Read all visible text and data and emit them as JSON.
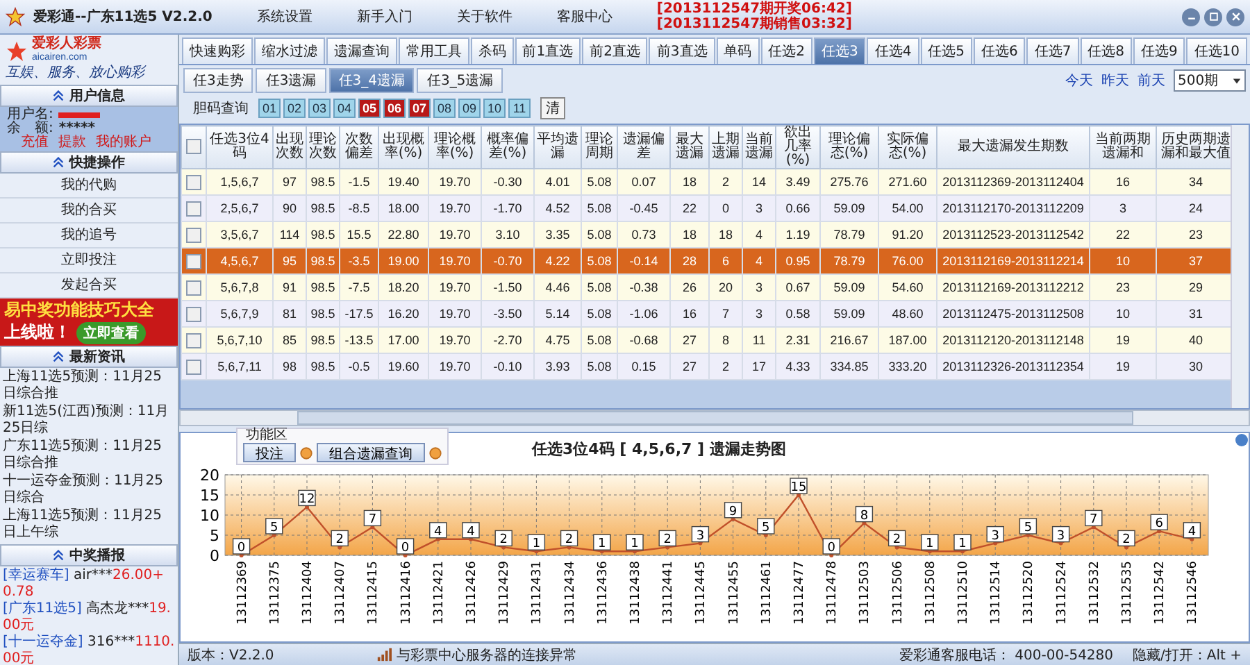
{
  "window": {
    "title": "爱彩通--广东11选5  V2.2.0"
  },
  "menu": [
    "系统设置",
    "新手入门",
    "关于软件",
    "客服中心"
  ],
  "notices": [
    "[2013112547期开奖06:42]",
    "[2013112547期销售03:32]"
  ],
  "sidebar": {
    "logo": {
      "name": "爱彩人彩票",
      "site": "aicairen.com",
      "slogan": "互娱、服务、放心购彩"
    },
    "user_info": {
      "heading": "用户信息",
      "username_label": "用户名:",
      "balance_label": "余　额:",
      "balance": "*****",
      "links": [
        "充值",
        "提款",
        "我的账户"
      ]
    },
    "quick_ops": {
      "heading": "快捷操作",
      "items": [
        "我的代购",
        "我的合买",
        "我的追号",
        "立即投注",
        "发起合买"
      ]
    },
    "banner": {
      "headline": "易中奖功能技巧大全",
      "subline": "上线啦！",
      "button": "立即查看"
    },
    "news": {
      "heading": "最新资讯",
      "items": [
        "上海11选5预测：11月25日综合推",
        "新11选5(江西)预测：11月25日综",
        "广东11选5预测：11月25日综合推",
        "十一运夺金预测：11月25日综合",
        "上海11选5预测：11月25日上午综"
      ]
    },
    "winners": {
      "heading": "中奖播报",
      "items": [
        {
          "lottery": "[幸运赛车]",
          "user": "air***",
          "amount": "26.00+0.78"
        },
        {
          "lottery": "[广东11选5]",
          "user": "高杰龙***",
          "amount": "19.00元"
        },
        {
          "lottery": "[十一运夺金]",
          "user": "316***",
          "amount": "1110.00元"
        }
      ]
    }
  },
  "tabs": [
    {
      "label": "快速购彩",
      "selected": false
    },
    {
      "label": "缩水过滤",
      "selected": false
    },
    {
      "label": "遗漏查询",
      "selected": false
    },
    {
      "label": "常用工具",
      "selected": false
    },
    {
      "label": "杀码",
      "selected": false
    },
    {
      "label": "前1直选",
      "selected": false
    },
    {
      "label": "前2直选",
      "selected": false
    },
    {
      "label": "前3直选",
      "selected": false
    },
    {
      "label": "单码",
      "selected": false
    },
    {
      "label": "任选2",
      "selected": false
    },
    {
      "label": "任选3",
      "selected": true
    },
    {
      "label": "任选4",
      "selected": false
    },
    {
      "label": "任选5",
      "selected": false
    },
    {
      "label": "任选6",
      "selected": false
    },
    {
      "label": "任选7",
      "selected": false
    },
    {
      "label": "任选8",
      "selected": false
    },
    {
      "label": "任选9",
      "selected": false
    },
    {
      "label": "任选10",
      "selected": false
    }
  ],
  "sub_tabs": [
    {
      "label": "任3走势",
      "selected": false
    },
    {
      "label": "任3遗漏",
      "selected": false
    },
    {
      "label": "任3_4遗漏",
      "selected": true
    },
    {
      "label": "任3_5遗漏",
      "selected": false
    }
  ],
  "day_links": [
    "今天",
    "昨天",
    "前天"
  ],
  "period_select": "500期",
  "number_filter": {
    "label": "胆码查询",
    "clear": "清",
    "numbers": [
      {
        "label": "01",
        "selected": false
      },
      {
        "label": "02",
        "selected": false
      },
      {
        "label": "03",
        "selected": false
      },
      {
        "label": "04",
        "selected": false
      },
      {
        "label": "05",
        "selected": true
      },
      {
        "label": "06",
        "selected": true
      },
      {
        "label": "07",
        "selected": true
      },
      {
        "label": "08",
        "selected": false
      },
      {
        "label": "09",
        "selected": false
      },
      {
        "label": "10",
        "selected": false
      },
      {
        "label": "11",
        "selected": false
      }
    ]
  },
  "table": {
    "header_checked": false,
    "columns": [
      "任选3位4码",
      "出现次数",
      "理论次数",
      "次数偏差",
      "出现概率(%)",
      "理论概率(%)",
      "概率偏差(%)",
      "平均遗漏",
      "理论周期",
      "遗漏偏差",
      "最大遗漏",
      "上期遗漏",
      "当前遗漏",
      "欲出几率(%)",
      "理论偏态(%)",
      "实际偏态(%)",
      "最大遗漏发生期数",
      "当前两期遗漏和",
      "历史两期遗漏和最大值"
    ],
    "rows": [
      {
        "selected": false,
        "checked": false,
        "cells": [
          "1,5,6,7",
          "97",
          "98.5",
          "-1.5",
          "19.40",
          "19.70",
          "-0.30",
          "4.01",
          "5.08",
          "0.07",
          "18",
          "2",
          "14",
          "3.49",
          "275.76",
          "271.60",
          "2013112369-2013112404",
          "16",
          "34"
        ]
      },
      {
        "selected": false,
        "checked": false,
        "cells": [
          "2,5,6,7",
          "90",
          "98.5",
          "-8.5",
          "18.00",
          "19.70",
          "-1.70",
          "4.52",
          "5.08",
          "-0.45",
          "22",
          "0",
          "3",
          "0.66",
          "59.09",
          "54.00",
          "2013112170-2013112209",
          "3",
          "24"
        ]
      },
      {
        "selected": false,
        "checked": false,
        "cells": [
          "3,5,6,7",
          "114",
          "98.5",
          "15.5",
          "22.80",
          "19.70",
          "3.10",
          "3.35",
          "5.08",
          "0.73",
          "18",
          "18",
          "4",
          "1.19",
          "78.79",
          "91.20",
          "2013112523-2013112542",
          "22",
          "23"
        ]
      },
      {
        "selected": true,
        "checked": false,
        "cells": [
          "4,5,6,7",
          "95",
          "98.5",
          "-3.5",
          "19.00",
          "19.70",
          "-0.70",
          "4.22",
          "5.08",
          "-0.14",
          "28",
          "6",
          "4",
          "0.95",
          "78.79",
          "76.00",
          "2013112169-2013112214",
          "10",
          "37"
        ]
      },
      {
        "selected": false,
        "checked": false,
        "cells": [
          "5,6,7,8",
          "91",
          "98.5",
          "-7.5",
          "18.20",
          "19.70",
          "-1.50",
          "4.46",
          "5.08",
          "-0.38",
          "26",
          "20",
          "3",
          "0.67",
          "59.09",
          "54.60",
          "2013112169-2013112212",
          "23",
          "29"
        ]
      },
      {
        "selected": false,
        "checked": false,
        "cells": [
          "5,6,7,9",
          "81",
          "98.5",
          "-17.5",
          "16.20",
          "19.70",
          "-3.50",
          "5.14",
          "5.08",
          "-1.06",
          "16",
          "7",
          "3",
          "0.58",
          "59.09",
          "48.60",
          "2013112475-2013112508",
          "10",
          "31"
        ]
      },
      {
        "selected": false,
        "checked": false,
        "cells": [
          "5,6,7,10",
          "85",
          "98.5",
          "-13.5",
          "17.00",
          "19.70",
          "-2.70",
          "4.75",
          "5.08",
          "-0.68",
          "27",
          "8",
          "11",
          "2.31",
          "216.67",
          "187.00",
          "2013112120-2013112148",
          "19",
          "40"
        ]
      },
      {
        "selected": false,
        "checked": false,
        "cells": [
          "5,6,7,11",
          "98",
          "98.5",
          "-0.5",
          "19.60",
          "19.70",
          "-0.10",
          "3.93",
          "5.08",
          "0.15",
          "27",
          "2",
          "17",
          "4.33",
          "334.85",
          "333.20",
          "2013112326-2013112354",
          "19",
          "30"
        ]
      }
    ]
  },
  "function_area": {
    "legend": "功能区",
    "buttons": [
      "投注",
      "组合遗漏查询"
    ]
  },
  "chart": {
    "title": "任选3位4码 [ 4,5,6,7 ] 遗漏走势图",
    "chart_data": {
      "type": "line",
      "categories": [
        "13112369",
        "13112375",
        "13112404",
        "13112407",
        "13112415",
        "13112416",
        "13112421",
        "13112426",
        "13112429",
        "13112431",
        "13112434",
        "13112436",
        "13112438",
        "13112441",
        "13112445",
        "13112455",
        "13112461",
        "13112477",
        "13112478",
        "13112503",
        "13112506",
        "13112508",
        "13112510",
        "13112514",
        "13112520",
        "13112524",
        "13112532",
        "13112535",
        "13112542",
        "13112546"
      ],
      "series": [
        {
          "color": "#c0502a",
          "marker": "circle",
          "values": [
            0,
            5,
            12,
            2,
            7,
            0,
            4,
            4,
            2,
            1,
            2,
            1,
            1,
            2,
            3,
            9,
            5,
            15,
            0,
            8,
            2,
            1,
            1,
            3,
            5,
            3,
            7,
            2,
            6,
            4
          ]
        }
      ],
      "ylim": [
        0,
        20
      ],
      "yticks": [
        0,
        5,
        10,
        15,
        20
      ],
      "grid": true,
      "data_labels": true
    }
  },
  "status_bar": {
    "version": "版本：V2.2.0",
    "connection": "与彩票中心服务器的连接异常",
    "hotline": "爱彩通客服电话：  400-00-54280",
    "hotkey": "隐藏/打开：Alt +"
  }
}
